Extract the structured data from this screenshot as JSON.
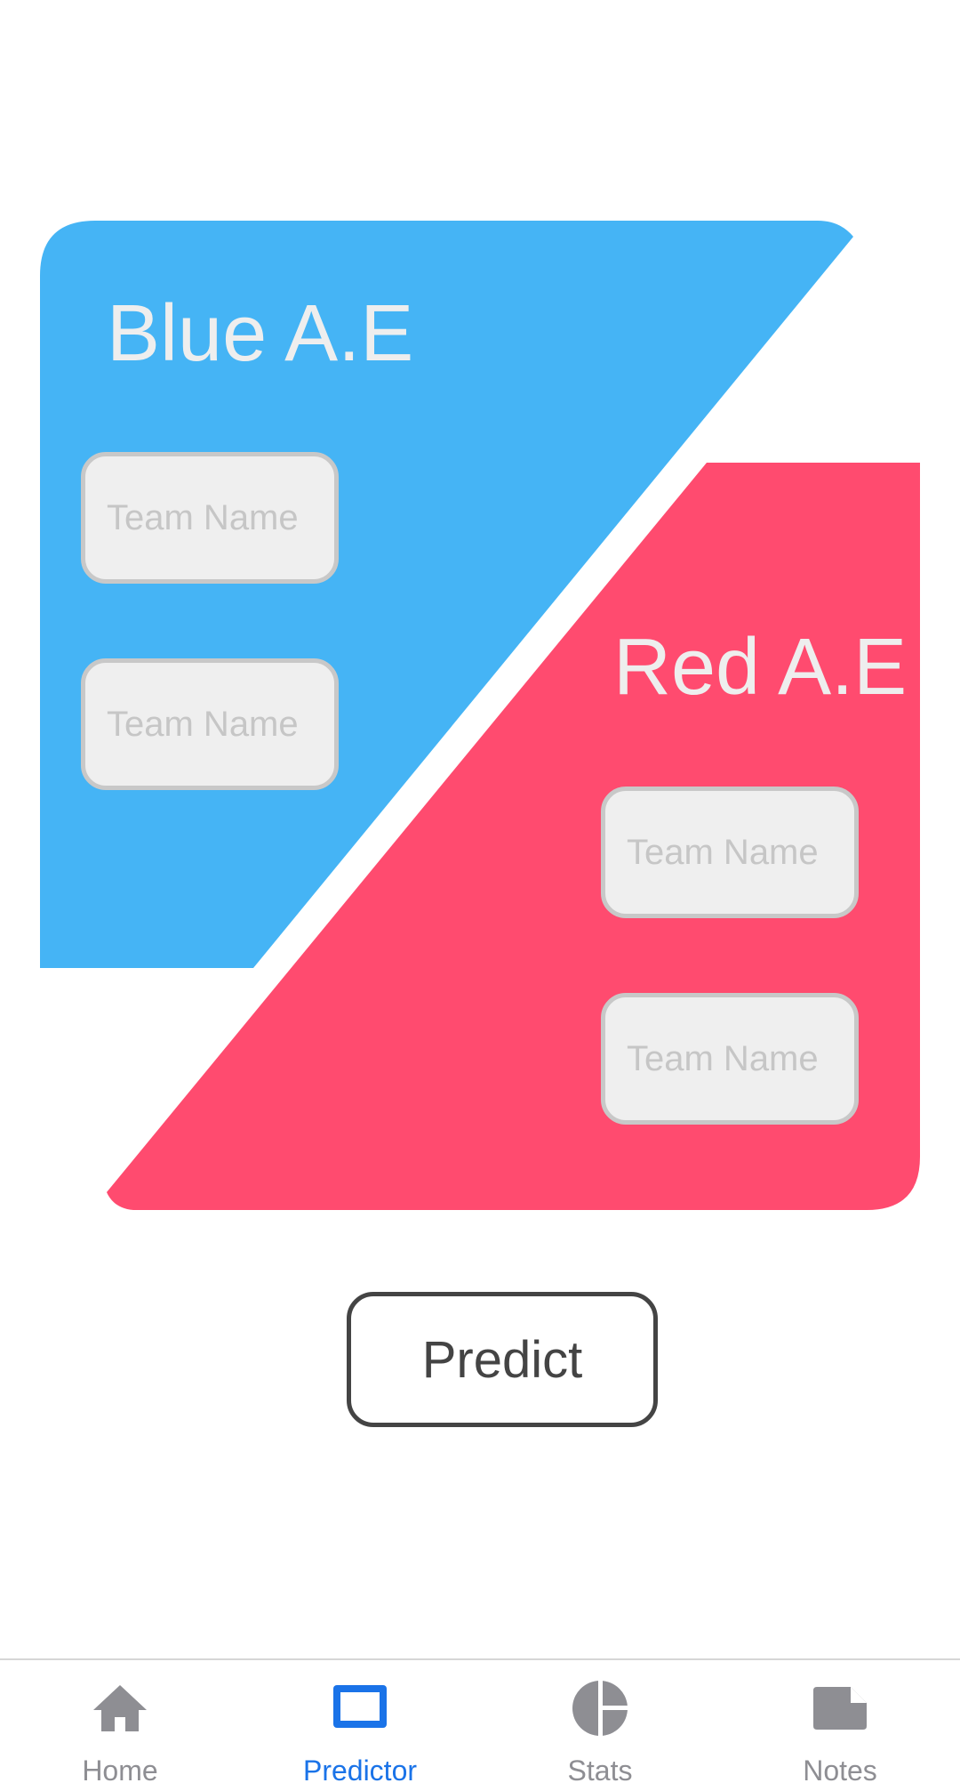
{
  "blue_team": {
    "title": "Blue A.E",
    "color": "#45b4f5",
    "inputs": [
      {
        "value": "",
        "placeholder": "Team Name"
      },
      {
        "value": "",
        "placeholder": "Team Name"
      }
    ]
  },
  "red_team": {
    "title": "Red A.E",
    "color": "#ff4b6f",
    "inputs": [
      {
        "value": "",
        "placeholder": "Team Name"
      },
      {
        "value": "",
        "placeholder": "Team Name"
      }
    ]
  },
  "predict_button": {
    "label": "Predict"
  },
  "tab_bar": {
    "active_color": "#1a73e8",
    "inactive_color": "#8e8e93",
    "tabs": [
      {
        "label": "Home",
        "icon": "home-icon",
        "active": false
      },
      {
        "label": "Predictor",
        "icon": "square-outline-icon",
        "active": true
      },
      {
        "label": "Stats",
        "icon": "pie-chart-icon",
        "active": false
      },
      {
        "label": "Notes",
        "icon": "note-icon",
        "active": false
      }
    ]
  }
}
